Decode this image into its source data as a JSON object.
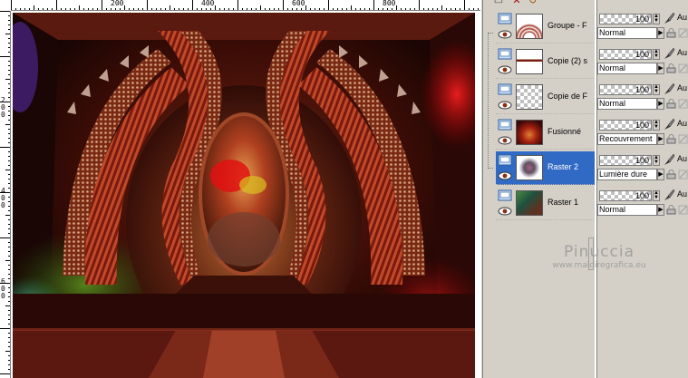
{
  "rulers": {
    "top_labels": [
      "200",
      "400",
      "600",
      "800"
    ],
    "left_labels": [
      "200",
      "400",
      "600"
    ]
  },
  "layers": [
    {
      "name": "Groupe - F",
      "thumb": "group",
      "selected": false
    },
    {
      "name": "Copie (2) s",
      "thumb": "stripes",
      "selected": false
    },
    {
      "name": "Copie de F",
      "thumb": "checker",
      "selected": false
    },
    {
      "name": "Fusionné",
      "thumb": "merged",
      "selected": false
    },
    {
      "name": "Raster 2",
      "thumb": "raster2",
      "selected": true
    },
    {
      "name": "Raster 1",
      "thumb": "raster1",
      "selected": false
    }
  ],
  "properties": [
    {
      "opacity": "100",
      "blend": "Normal",
      "label": "Au"
    },
    {
      "opacity": "100",
      "blend": "Normal",
      "label": "Au"
    },
    {
      "opacity": "100",
      "blend": "Normal",
      "label": "Au"
    },
    {
      "opacity": "100",
      "blend": "Recouvrement",
      "label": "Au"
    },
    {
      "opacity": "100",
      "blend": "Lumière dure",
      "label": "Au"
    },
    {
      "opacity": "100",
      "blend": "Normal",
      "label": "Au"
    }
  ],
  "watermark": {
    "title": "Pinuccia",
    "url": "www.maidiregrafica.eu"
  },
  "colors": {
    "selection": "#316ac5",
    "panel": "#d4d0c8",
    "artwork_red": "#8b1a10"
  }
}
